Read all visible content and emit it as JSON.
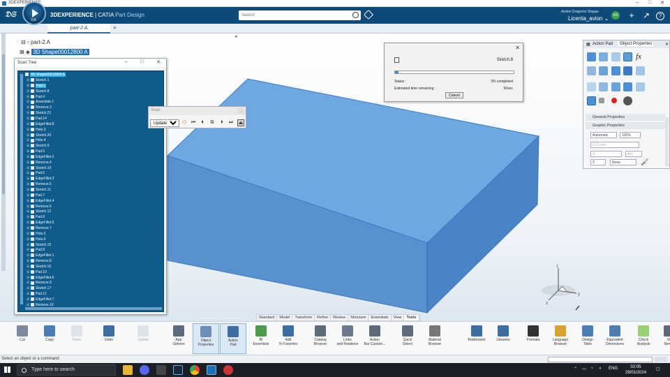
{
  "window": {
    "title": "3DEXPERIENCE",
    "min": "–",
    "max": "□",
    "close": "✕"
  },
  "header": {
    "brand": "3DEXPERIENCE",
    "sep": " | ",
    "product": "CATIA",
    "app": "Part Design",
    "compass_label": "V,R",
    "search_placeholder": "Search",
    "user": "Andrei Dragomir Sfagau",
    "collab_space": "Licenta_avion ⌄",
    "avatar_initials": "AS",
    "add": "+",
    "share": "↗",
    "help": "?"
  },
  "tabs": {
    "active": "part-2 A",
    "add": "+"
  },
  "tree": {
    "root": "part-2 A",
    "shape": "3D Shape00012800 A"
  },
  "scan_tree": {
    "title": "Scan Tree",
    "root": "3D Shape00012800 A",
    "nodes": [
      "Sketch.1",
      "Pad.1",
      "Sketch.8",
      "Pad.4",
      "Assemble.1",
      "Remove.3",
      "Sketch.21",
      "Pad.14",
      "EdgeFillet.8",
      "Hole.3",
      "Sketch.20",
      "Hole.4",
      "Sketch.9",
      "Pad.5",
      "EdgeFillet.2",
      "Remove.4",
      "Sketch.10",
      "Pad.6",
      "EdgeFillet.3",
      "Remove.5",
      "Sketch.11",
      "Pad.7",
      "EdgeFillet.4",
      "Remove.6",
      "Sketch.12",
      "Pad.8",
      "EdgeFillet.5",
      "Remove.7",
      "Hole.5",
      "Hole.6",
      "Sketch.15",
      "Pad.9",
      "EdgeFillet.1",
      "Remove.8",
      "Sketch.16",
      "Pad.10",
      "EdgeFillet.6",
      "Remove.9",
      "Sketch.17",
      "Pad.11",
      "EdgeFillet.7",
      "Remove.10"
    ],
    "highlighted": "Pad.1"
  },
  "scan_toolbar": {
    "title": "Scan",
    "mode": "Update",
    "options": [
      "Update"
    ]
  },
  "progress": {
    "current": "Sketch.8",
    "status_label": "Status :",
    "status_value": "3% completed",
    "remaining_label": "Estimated time remaining :",
    "remaining_value": "50sec",
    "percent": 3,
    "cancel": "Cancel"
  },
  "action_pad": {
    "tab1": "Action Pad",
    "tab2": "Object Properties",
    "close": "✕",
    "section1": "General Properties",
    "section2": "Graphic Properties",
    "field_auto": "Automatic",
    "field_pct": "100%",
    "field_thick": "0.13 mm",
    "field_zero": "0",
    "field_act": "Act",
    "field_three": "3",
    "field_none": "None"
  },
  "section_tabs": [
    "Standard",
    "Model",
    "Transform",
    "Refine",
    "Review",
    "Structure",
    "Essentials",
    "View",
    "Tools"
  ],
  "active_section": "Tools",
  "toolbar": [
    {
      "label": "Cut",
      "icon": "scissors-icon"
    },
    {
      "label": "Copy",
      "icon": "copy-icon"
    },
    {
      "label": "Paste",
      "icon": "paste-icon"
    },
    {
      "label": "Undo",
      "icon": "undo-icon"
    },
    {
      "label": "Update",
      "icon": "update-icon"
    },
    {
      "label": "App\nOptions",
      "icon": "app-options-icon"
    },
    {
      "label": "Object\nProperties",
      "icon": "object-properties-icon"
    },
    {
      "label": "Action\nPad",
      "icon": "action-pad-icon"
    },
    {
      "label": "BI\nEssentials",
      "icon": "bi-essentials-icon"
    },
    {
      "label": "Add\nTo Favorites",
      "icon": "star-icon"
    },
    {
      "label": "Catalog\nBrowser",
      "icon": "catalog-icon"
    },
    {
      "label": "Links\nand Relations",
      "icon": "links-icon"
    },
    {
      "label": "Action\nBar Custom...",
      "icon": "action-bar-custom-icon"
    },
    {
      "label": "Quick\nSelect",
      "icon": "quick-select-icon"
    },
    {
      "label": "Material\nBrowser",
      "icon": "material-browser-icon"
    },
    {
      "label": "Bookmarks",
      "icon": "bookmarks-icon"
    },
    {
      "label": "Libraries",
      "icon": "libraries-icon"
    },
    {
      "label": "Formula",
      "icon": "formula-icon"
    },
    {
      "label": "Language\nBrowser",
      "icon": "language-browser-icon"
    },
    {
      "label": "Design\nTable",
      "icon": "design-table-icon"
    },
    {
      "label": "Equivalent\nDimensions",
      "icon": "equivalent-dimensions-icon"
    },
    {
      "label": "Check\nAnalysis",
      "icon": "check-analysis-icon"
    },
    {
      "label": "Vis\nNew C",
      "icon": "visualization-icon"
    }
  ],
  "status": {
    "text": "Select an object or a command"
  },
  "taskbar": {
    "search": "Type here to search",
    "lang": "ENG",
    "time": "02:05",
    "date": "29/01/2024"
  },
  "colors": {
    "header": "#0e4a78",
    "tree_bg": "#0f5c8c",
    "box_top": "#6aa7e0",
    "box_side": "#4f8cc8"
  }
}
